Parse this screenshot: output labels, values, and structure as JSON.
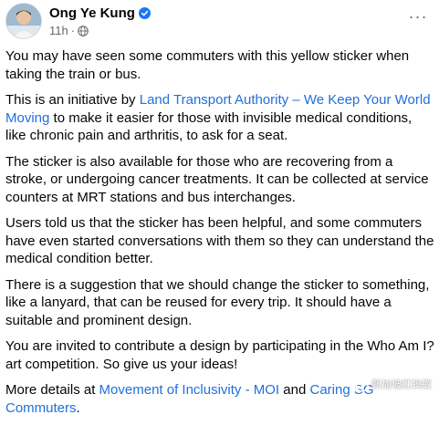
{
  "post": {
    "author": "Ong Ye Kung",
    "timestamp": "11h",
    "separator": "·",
    "more_label": "···",
    "paragraphs": [
      {
        "segments": [
          {
            "text": "You may have seen some commuters with this yellow sticker when taking the train or bus."
          }
        ]
      },
      {
        "segments": [
          {
            "text": "This is an initiative by "
          },
          {
            "text": "Land Transport Authority – We Keep Your World Moving",
            "link": true
          },
          {
            "text": " to make it easier for those with invisible medical conditions, like chronic pain and arthritis, to ask for a seat."
          }
        ]
      },
      {
        "segments": [
          {
            "text": "The sticker is also available for those who are recovering from a stroke, or undergoing cancer treatments. It can be collected at service counters at MRT stations and bus interchanges."
          }
        ]
      },
      {
        "segments": [
          {
            "text": "Users told us that the sticker has been helpful, and some commuters have even started conversations with them so they can understand the medical condition better."
          }
        ]
      },
      {
        "segments": [
          {
            "text": "There is a suggestion that we should change the sticker to something, like a lanyard, that can be reused for every trip. It should have a suitable and prominent design."
          }
        ]
      },
      {
        "segments": [
          {
            "text": "You are invited to contribute a design by participating in the Who Am I? art competition. So give us your ideas!"
          }
        ]
      },
      {
        "segments": [
          {
            "text": "More details at "
          },
          {
            "text": "Movement of Inclusivity - MOI",
            "link": true
          },
          {
            "text": " and "
          },
          {
            "text": "Caring SG Commuters",
            "link": true
          },
          {
            "text": "."
          }
        ]
      }
    ]
  },
  "watermark": {
    "text": "新加坡红蚂蚁"
  },
  "colors": {
    "link": "#216fdb",
    "verified": "#1877f2",
    "meta": "#65676b"
  },
  "icons": {
    "verified": "verified-badge-icon",
    "globe": "globe-icon",
    "watermark": "chat-bubble-icon"
  }
}
